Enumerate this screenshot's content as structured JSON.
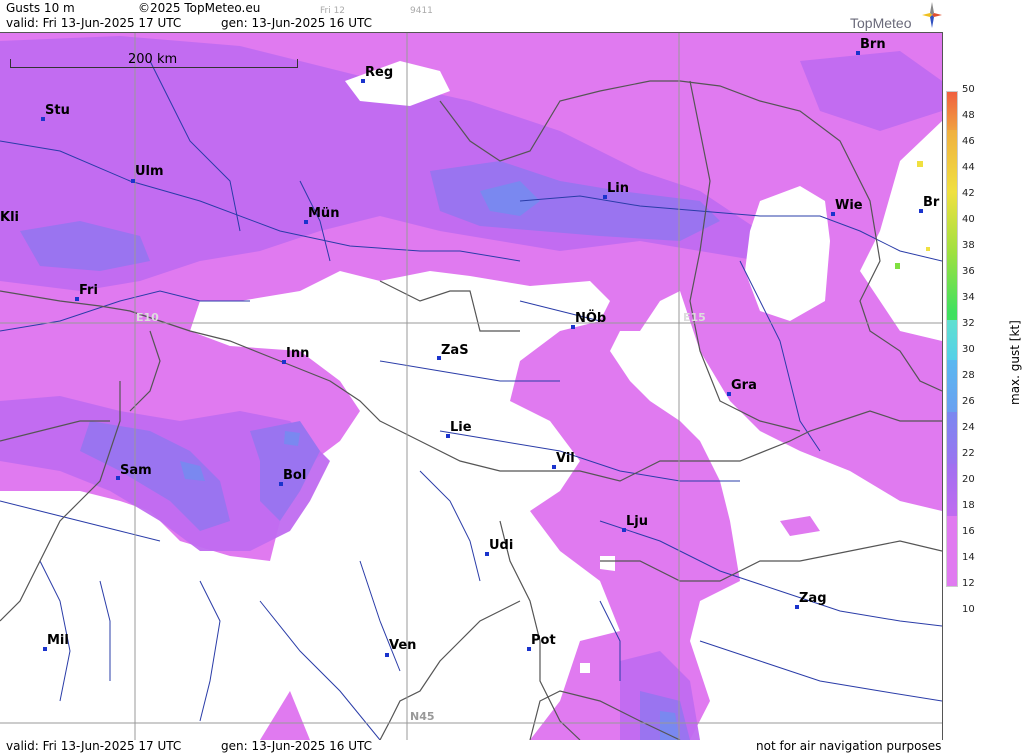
{
  "header": {
    "title": "Gusts 10 m",
    "copyright": "©2025 TopMeteo.eu",
    "small_day": "Fri 12",
    "small_code": "9411",
    "valid": "valid:  Fri  13-Jun-2025  17 UTC",
    "gen": "gen: 13-Jun-2025 16 UTC",
    "brand": "TopMeteo"
  },
  "footer": {
    "valid": "valid:  Fri  13-Jun-2025  17 UTC",
    "gen": "gen: 13-Jun-2025 16 UTC",
    "note": "not for air navigation purposes"
  },
  "map": {
    "scale_label": "200 km",
    "grid_labels": [
      "E10",
      "E15",
      "N45"
    ],
    "cities": [
      "Brn",
      "Reg",
      "Stu",
      "Ulm",
      "Lin",
      "Kli",
      "Mün",
      "Wie",
      "Br",
      "Fri",
      "NÖb",
      "Inn",
      "ZaS",
      "Gra",
      "Lie",
      "Vil",
      "Sam",
      "Bol",
      "Lju",
      "Udi",
      "Zag",
      "Mil",
      "Ven",
      "Pot"
    ]
  },
  "legend": {
    "label": "max. gust  [kt]",
    "ticks": [
      "50",
      "48",
      "46",
      "44",
      "42",
      "40",
      "38",
      "36",
      "34",
      "32",
      "30",
      "28",
      "26",
      "24",
      "22",
      "20",
      "18",
      "16",
      "14",
      "12",
      "10"
    ],
    "colors": {
      "c12": "#e07af0",
      "c14": "#c06cf0",
      "c16": "#a070f0",
      "c18": "#8a7af0",
      "c20": "#7a88f0",
      "c22": "#6aa0f0",
      "c24": "#5ab8f0",
      "c26": "#55d0e8",
      "c28": "#60e0d0",
      "c30": "#40e060",
      "c34": "#80e040",
      "c38": "#c8e040",
      "c42": "#f0e040",
      "c46": "#f0b040",
      "c50": "#f06040"
    }
  }
}
